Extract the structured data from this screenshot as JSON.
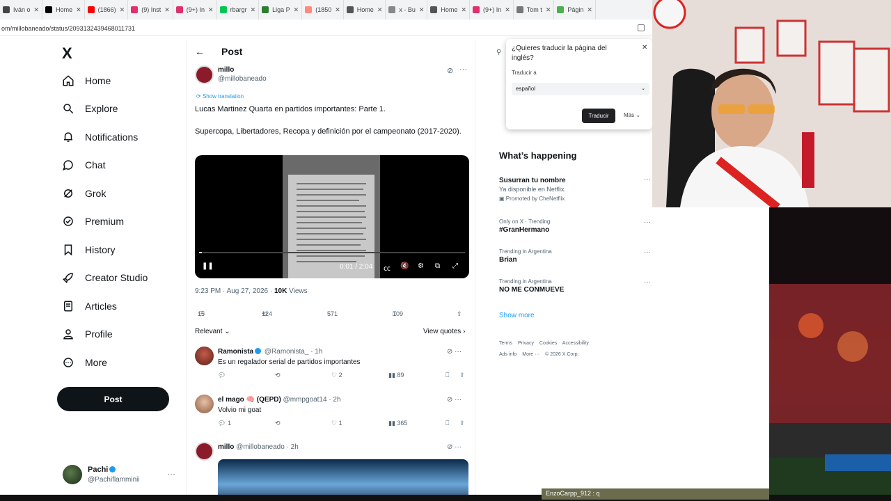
{
  "browser": {
    "tabs": [
      {
        "label": "Iván o",
        "color": "#444444"
      },
      {
        "label": "Home",
        "color": "#000000"
      },
      {
        "label": "(1866)",
        "color": "#ff0000"
      },
      {
        "label": "(9) Inst",
        "color": "#e1306c"
      },
      {
        "label": "(9+) In",
        "color": "#e1306c"
      },
      {
        "label": "rbargr",
        "color": "#00c853"
      },
      {
        "label": "Liga P",
        "color": "#2e7d32"
      },
      {
        "label": "(1850",
        "color": "#ff8a80"
      },
      {
        "label": "Home",
        "color": "#555555"
      },
      {
        "label": "x - Bu",
        "color": "#888888"
      },
      {
        "label": "Home",
        "color": "#555555"
      },
      {
        "label": "(9+) In",
        "color": "#e1306c"
      },
      {
        "label": "Tom t",
        "color": "#777777"
      },
      {
        "label": "Págin",
        "color": "#4caf50"
      }
    ],
    "url": "om/millobaneado/status/2093132439468011731"
  },
  "sidebar": {
    "logo": "X",
    "items": [
      {
        "label": "Home",
        "icon": "home-icon"
      },
      {
        "label": "Explore",
        "icon": "search-icon"
      },
      {
        "label": "Notifications",
        "icon": "bell-icon"
      },
      {
        "label": "Chat",
        "icon": "chat-icon"
      },
      {
        "label": "Grok",
        "icon": "grok-icon"
      },
      {
        "label": "Premium",
        "icon": "premium-icon"
      },
      {
        "label": "History",
        "icon": "bookmark-icon"
      },
      {
        "label": "Creator Studio",
        "icon": "rocket-icon"
      },
      {
        "label": "Articles",
        "icon": "article-icon"
      },
      {
        "label": "Profile",
        "icon": "person-icon"
      },
      {
        "label": "More",
        "icon": "more-icon"
      }
    ],
    "post_label": "Post",
    "account": {
      "name": "Pachi",
      "handle": "@Pachiflamminii"
    }
  },
  "post": {
    "header_title": "Post",
    "author_name": "millo",
    "author_handle": "@millobaneado",
    "show_translation": "Show translation",
    "text": "Lucas Martinez Quarta en partidos importantes: Parte 1.\n\nSupercopa, Libertadores, Recopa y definición por el campeonato (2017-2020).",
    "video_time": "0:01 / 2:04",
    "video_progress": 0.01,
    "timestamp": "9:23 PM · Aug 27, 2026 · ",
    "views": "10K",
    "views_label": " Views",
    "replies": "15",
    "reposts": "124",
    "likes": "571",
    "bookmarks": "109",
    "relevant_label": "Relevant",
    "view_quotes": "View quotes"
  },
  "replies": [
    {
      "name": "Ramonista",
      "handle": "@Ramonista_ · 1h",
      "text": "Es un regalador serial de partidos importantes",
      "reply_count": "",
      "likes": "2",
      "views": "89"
    },
    {
      "name": "el mago 🧠 (QEPD)",
      "handle": "@mmpgoat14 · 2h",
      "text": "Volvio mi goat",
      "reply_count": "1",
      "likes": "1",
      "views": "365"
    },
    {
      "name": "millo",
      "handle": "@millobaneado · 2h"
    }
  ],
  "trends": {
    "title": "What’s happening",
    "items": [
      {
        "context": "",
        "name": "Susurran tu nombre",
        "sub": "Ya disponible en Netflix.",
        "promo": "Promoted by CheNetflix"
      },
      {
        "context": "Only on X · Trending",
        "name": "#GranHermano"
      },
      {
        "context": "Trending in Argentina",
        "name": "Brian"
      },
      {
        "context": "Trending in Argentina",
        "name": "NO ME CONMUEVE"
      }
    ],
    "show_more": "Show more"
  },
  "footer": {
    "links": [
      "Terms",
      "Privacy",
      "Cookies",
      "Accessibility",
      "Ads info",
      "More ···",
      "© 2026 X Corp."
    ]
  },
  "translate_popup": {
    "question": "¿Quieres traducir la página del inglés?",
    "translate_to": "Traducir a",
    "language": "español",
    "translate_btn": "Traducir",
    "more": "Más"
  },
  "stream_chat": {
    "message": "EnzoCarpp_912 : q"
  }
}
